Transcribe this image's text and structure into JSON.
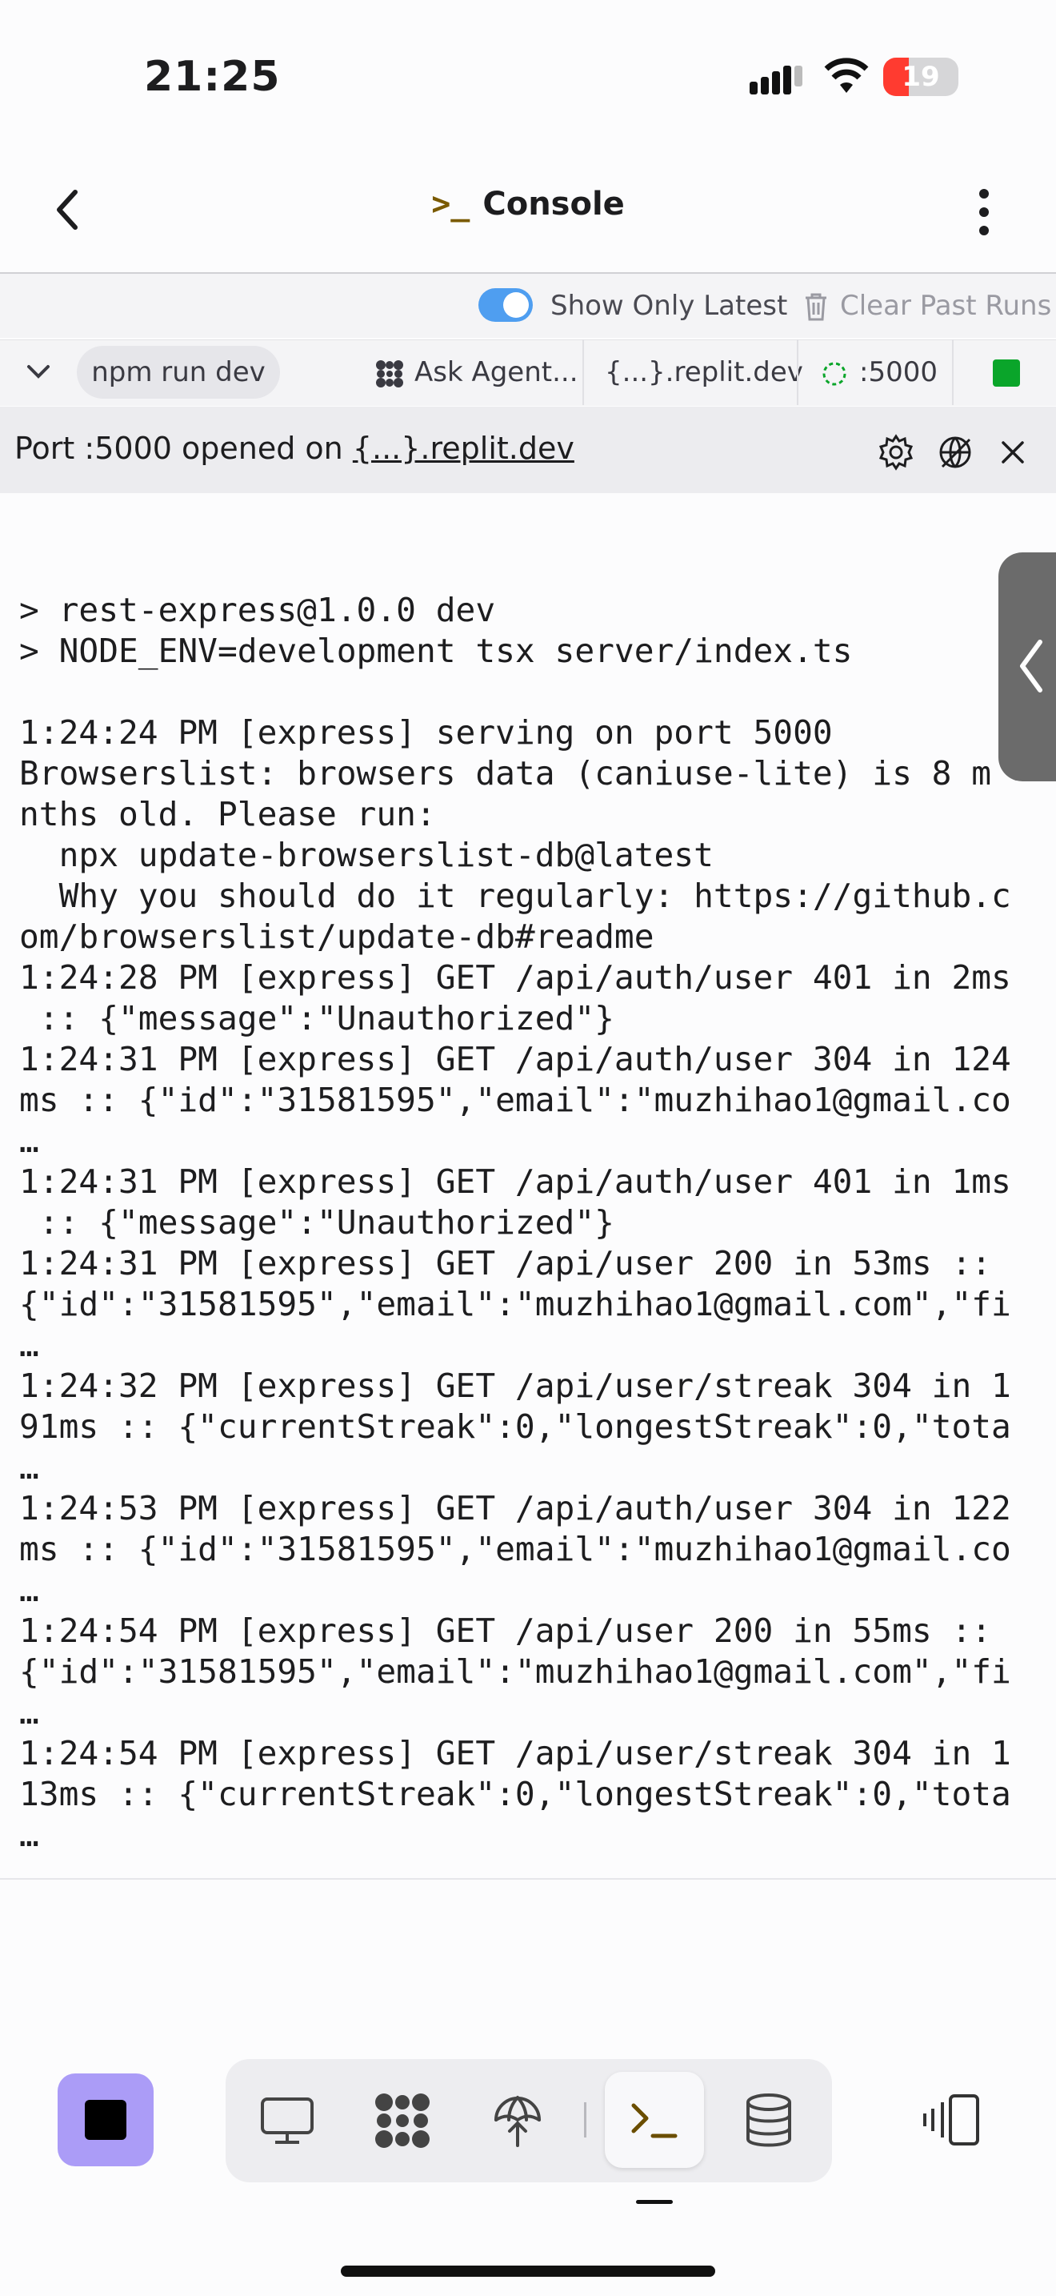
{
  "status_bar": {
    "time": "21:25",
    "battery": "19"
  },
  "header": {
    "title": "Console",
    "title_glyph": ">_"
  },
  "options": {
    "toggle_label": "Show Only Latest",
    "toggle_on": true,
    "clear_label": "Clear Past Runs"
  },
  "tabs": {
    "run_chip": "npm run dev",
    "ask_agent": "Ask Agent...",
    "domain": "{...}.replit.dev",
    "port": ":5000"
  },
  "banner": {
    "prefix": "Port :5000 opened on ",
    "link": "{...}.replit.dev"
  },
  "console_lines": [
    "",
    "> rest-express@1.0.0 dev",
    "> NODE_ENV=development tsx server/index.ts",
    "",
    "1:24:24 PM [express] serving on port 5000",
    "Browserslist: browsers data (caniuse-lite) is 8 m",
    "nths old. Please run:",
    "  npx update-browserslist-db@latest",
    "  Why you should do it regularly: https://github.c",
    "om/browserslist/update-db#readme",
    "1:24:28 PM [express] GET /api/auth/user 401 in 2ms",
    " :: {\"message\":\"Unauthorized\"}",
    "1:24:31 PM [express] GET /api/auth/user 304 in 124",
    "ms :: {\"id\":\"31581595\",\"email\":\"muzhihao1@gmail.co",
    "…",
    "1:24:31 PM [express] GET /api/auth/user 401 in 1ms",
    " :: {\"message\":\"Unauthorized\"}",
    "1:24:31 PM [express] GET /api/user 200 in 53ms ::",
    "{\"id\":\"31581595\",\"email\":\"muzhihao1@gmail.com\",\"fi",
    "…",
    "1:24:32 PM [express] GET /api/user/streak 304 in 1",
    "91ms :: {\"currentStreak\":0,\"longestStreak\":0,\"tota",
    "…",
    "1:24:53 PM [express] GET /api/auth/user 304 in 122",
    "ms :: {\"id\":\"31581595\",\"email\":\"muzhihao1@gmail.co",
    "…",
    "1:24:54 PM [express] GET /api/user 200 in 55ms ::",
    "{\"id\":\"31581595\",\"email\":\"muzhihao1@gmail.com\",\"fi",
    "…",
    "1:24:54 PM [express] GET /api/user/streak 304 in 1",
    "13ms :: {\"currentStreak\":0,\"longestStreak\":0,\"tota",
    "…"
  ],
  "colors": {
    "accent": "#4f9ef0",
    "stop_button": "#ab9cf7",
    "running": "#0aa52a",
    "prompt_glyph": "#7a5a00"
  },
  "toolbar_icons": [
    "monitor-icon",
    "agent-icon",
    "deploy-icon",
    "console-icon",
    "database-icon"
  ]
}
